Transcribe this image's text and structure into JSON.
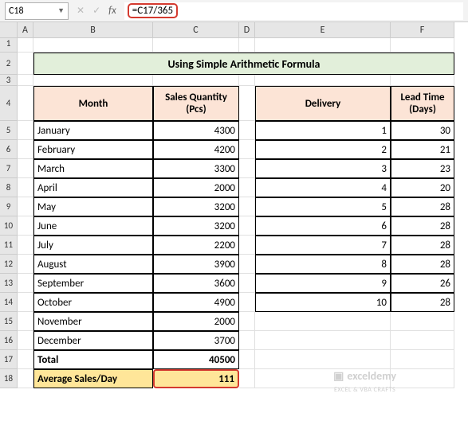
{
  "name_box": "C18",
  "formula": "=C17/365",
  "col_labels": [
    "A",
    "B",
    "C",
    "D",
    "E",
    "F"
  ],
  "row_labels": [
    "1",
    "2",
    "3",
    "4",
    "5",
    "6",
    "7",
    "8",
    "9",
    "10",
    "11",
    "12",
    "13",
    "14",
    "15",
    "16",
    "17",
    "18"
  ],
  "title": "Using Simple Arithmetic Formula",
  "headers": {
    "month": "Month",
    "sales": "Sales Quantity (Pcs)",
    "delivery": "Delivery",
    "lead": "Lead Time (Days)"
  },
  "months": [
    "January",
    "February",
    "March",
    "April",
    "May",
    "June",
    "July",
    "August",
    "September",
    "October",
    "November",
    "December"
  ],
  "sales": [
    "4300",
    "4200",
    "3300",
    "2000",
    "3200",
    "3200",
    "2200",
    "3900",
    "3600",
    "4900",
    "2000",
    "3700"
  ],
  "delivery_n": [
    "1",
    "2",
    "3",
    "4",
    "5",
    "6",
    "7",
    "8",
    "9",
    "10"
  ],
  "lead_time": [
    "30",
    "21",
    "23",
    "20",
    "28",
    "28",
    "28",
    "28",
    "26",
    "28"
  ],
  "total_label": "Total",
  "total_value": "40500",
  "avg_label": "Average Sales/Day",
  "avg_value": "111",
  "watermark": {
    "brand": "exceldemy",
    "sub": "EXCEL & VBA CRAFTS"
  },
  "chart_data": {
    "type": "table",
    "title": "Using Simple Arithmetic Formula",
    "tables": [
      {
        "columns": [
          "Month",
          "Sales Quantity (Pcs)"
        ],
        "rows": [
          [
            "January",
            4300
          ],
          [
            "February",
            4200
          ],
          [
            "March",
            3300
          ],
          [
            "April",
            2000
          ],
          [
            "May",
            3200
          ],
          [
            "June",
            3200
          ],
          [
            "July",
            2200
          ],
          [
            "August",
            3900
          ],
          [
            "September",
            3600
          ],
          [
            "October",
            4900
          ],
          [
            "November",
            2000
          ],
          [
            "December",
            3700
          ]
        ],
        "summary": {
          "Total": 40500,
          "Average Sales/Day": 111
        }
      },
      {
        "columns": [
          "Delivery",
          "Lead Time (Days)"
        ],
        "rows": [
          [
            1,
            30
          ],
          [
            2,
            21
          ],
          [
            3,
            23
          ],
          [
            4,
            20
          ],
          [
            5,
            28
          ],
          [
            6,
            28
          ],
          [
            7,
            28
          ],
          [
            8,
            28
          ],
          [
            9,
            26
          ],
          [
            10,
            28
          ]
        ]
      }
    ]
  }
}
